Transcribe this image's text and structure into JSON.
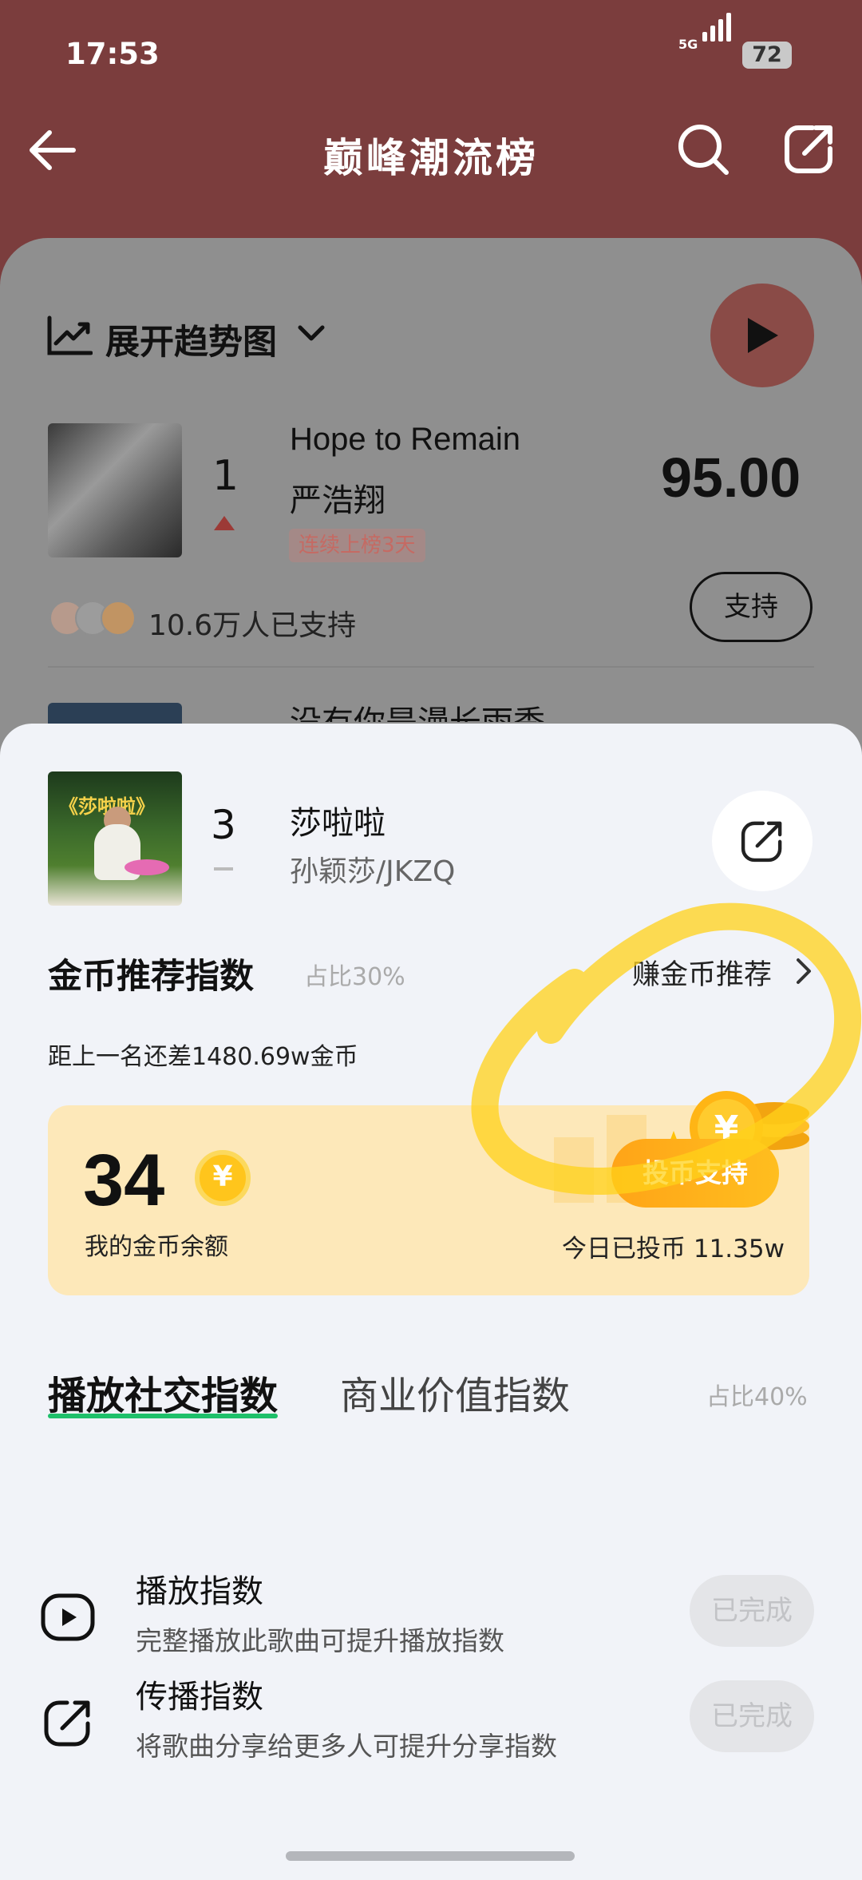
{
  "status_bar": {
    "time": "17:53",
    "network": "5G",
    "battery": "72"
  },
  "header": {
    "title": "巅峰潮流榜"
  },
  "trend": {
    "label": "展开趋势图"
  },
  "list": [
    {
      "rank": "1",
      "song": "Hope to Remain",
      "artist": "严浩翔",
      "badge": "连续上榜3天",
      "score": "95.00",
      "support_count": "10.6万人已支持",
      "support_label": "支持"
    },
    {
      "song": "没有你是漫长雨季"
    }
  ],
  "sheet": {
    "rank": "3",
    "song": "莎啦啦",
    "artist": "孙颖莎/JKZQ",
    "cover_title": "《莎啦啦》",
    "coin_title": "金币推荐指数",
    "coin_ratio": "占比30%",
    "earn_link": "赚金币推荐",
    "gap_text": "距上一名还差1480.69w金币",
    "balance": "34",
    "balance_label": "我的金币余额",
    "coin_button": "投币支持",
    "today_text": "今日已投币 11.35w",
    "yen_symbol": "¥",
    "tabs": [
      {
        "label": "播放社交指数",
        "active": true
      },
      {
        "label": "商业价值指数",
        "active": false
      }
    ],
    "tab_ratio": "占比40%",
    "tasks": [
      {
        "title": "播放指数",
        "desc": "完整播放此歌曲可提升播放指数",
        "status": "已完成",
        "icon": "play-icon"
      },
      {
        "title": "传播指数",
        "desc": "将歌曲分享给更多人可提升分享指数",
        "status": "已完成",
        "icon": "share-icon"
      }
    ]
  },
  "colors": {
    "header_bg": "#7b3d3d",
    "accent_green": "#1ec06a",
    "coin_orange": "#ffa417",
    "highlight_yellow": "#ffd21a"
  }
}
